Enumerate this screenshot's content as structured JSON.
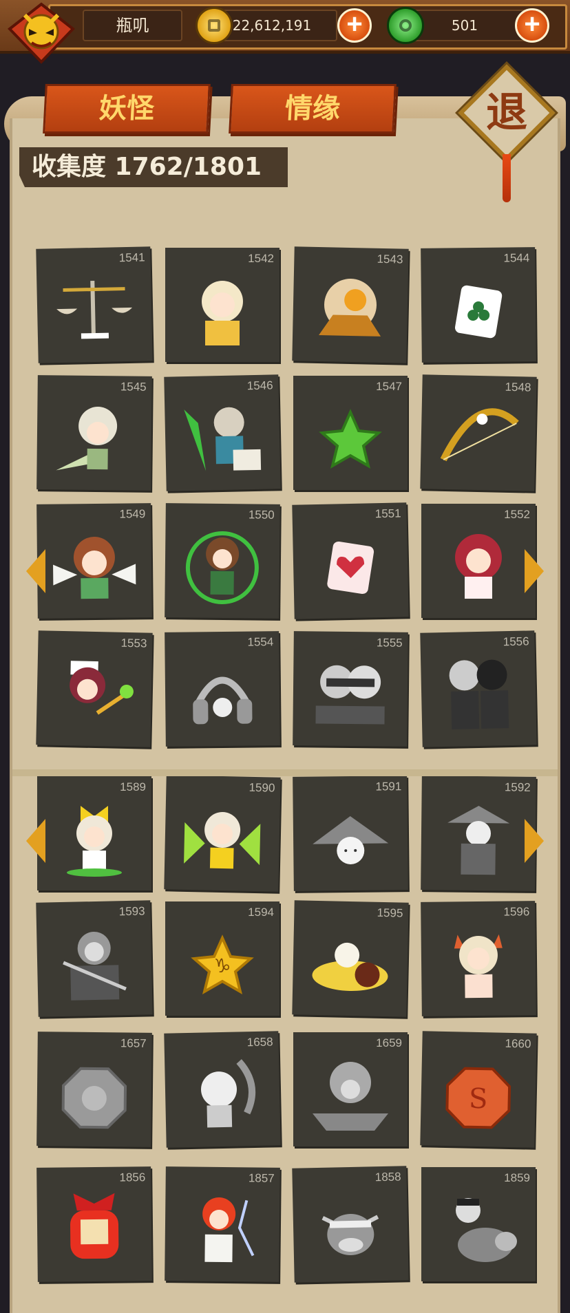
{
  "player": {
    "name": "瓶叽"
  },
  "resources": {
    "gold": "22,612,191",
    "jade": "501"
  },
  "tabs": [
    {
      "label": "妖怪"
    },
    {
      "label": "情缘"
    }
  ],
  "exit_label": "退",
  "progress_label": "收集度 1762/1801",
  "cards": [
    {
      "num": "1541",
      "icon": "balance-scale-icon",
      "gray": false
    },
    {
      "num": "1542",
      "icon": "winged-hero-icon",
      "gray": false
    },
    {
      "num": "1543",
      "icon": "golden-warrior-icon",
      "gray": false
    },
    {
      "num": "1544",
      "icon": "club-card-icon",
      "gray": false
    },
    {
      "num": "1545",
      "icon": "helmet-kid-icon",
      "gray": false
    },
    {
      "num": "1546",
      "icon": "knight-rider-icon",
      "gray": false
    },
    {
      "num": "1547",
      "icon": "green-star-icon",
      "gray": false
    },
    {
      "num": "1548",
      "icon": "bow-icon",
      "gray": false
    },
    {
      "num": "1549",
      "icon": "angel-girl-icon",
      "gray": false
    },
    {
      "num": "1550",
      "icon": "angel-archer-icon",
      "gray": false
    },
    {
      "num": "1551",
      "icon": "heart-card-icon",
      "gray": false
    },
    {
      "num": "1552",
      "icon": "red-hair-girl-icon",
      "gray": false
    },
    {
      "num": "1553",
      "icon": "nurse-girl-icon",
      "gray": false
    },
    {
      "num": "1554",
      "icon": "headphones-icon",
      "gray": true
    },
    {
      "num": "1555",
      "icon": "dj-duo-icon",
      "gray": true
    },
    {
      "num": "1556",
      "icon": "robot-duo-icon",
      "gray": true
    },
    {
      "num": "1589",
      "icon": "bow-girl-icon",
      "gray": false
    },
    {
      "num": "1590",
      "icon": "nature-girl-icon",
      "gray": false
    },
    {
      "num": "1591",
      "icon": "straw-hat-icon",
      "gray": true
    },
    {
      "num": "1592",
      "icon": "ronin-icon",
      "gray": true
    },
    {
      "num": "1593",
      "icon": "general-icon",
      "gray": true
    },
    {
      "num": "1594",
      "icon": "capricorn-star-icon",
      "gray": false
    },
    {
      "num": "1595",
      "icon": "burrito-icon",
      "gray": false
    },
    {
      "num": "1596",
      "icon": "horn-girl-icon",
      "gray": false
    },
    {
      "num": "1657",
      "icon": "octagon-seal-icon",
      "gray": true
    },
    {
      "num": "1658",
      "icon": "dragon-kid-icon",
      "gray": true
    },
    {
      "num": "1659",
      "icon": "lion-dance-icon",
      "gray": true
    },
    {
      "num": "1660",
      "icon": "red-seal-icon",
      "gray": false
    },
    {
      "num": "1856",
      "icon": "fortune-doll-icon",
      "gray": false
    },
    {
      "num": "1857",
      "icon": "fire-hero-icon",
      "gray": false
    },
    {
      "num": "1858",
      "icon": "ox-head-icon",
      "gray": true
    },
    {
      "num": "1859",
      "icon": "ox-rider-icon",
      "gray": true
    }
  ]
}
